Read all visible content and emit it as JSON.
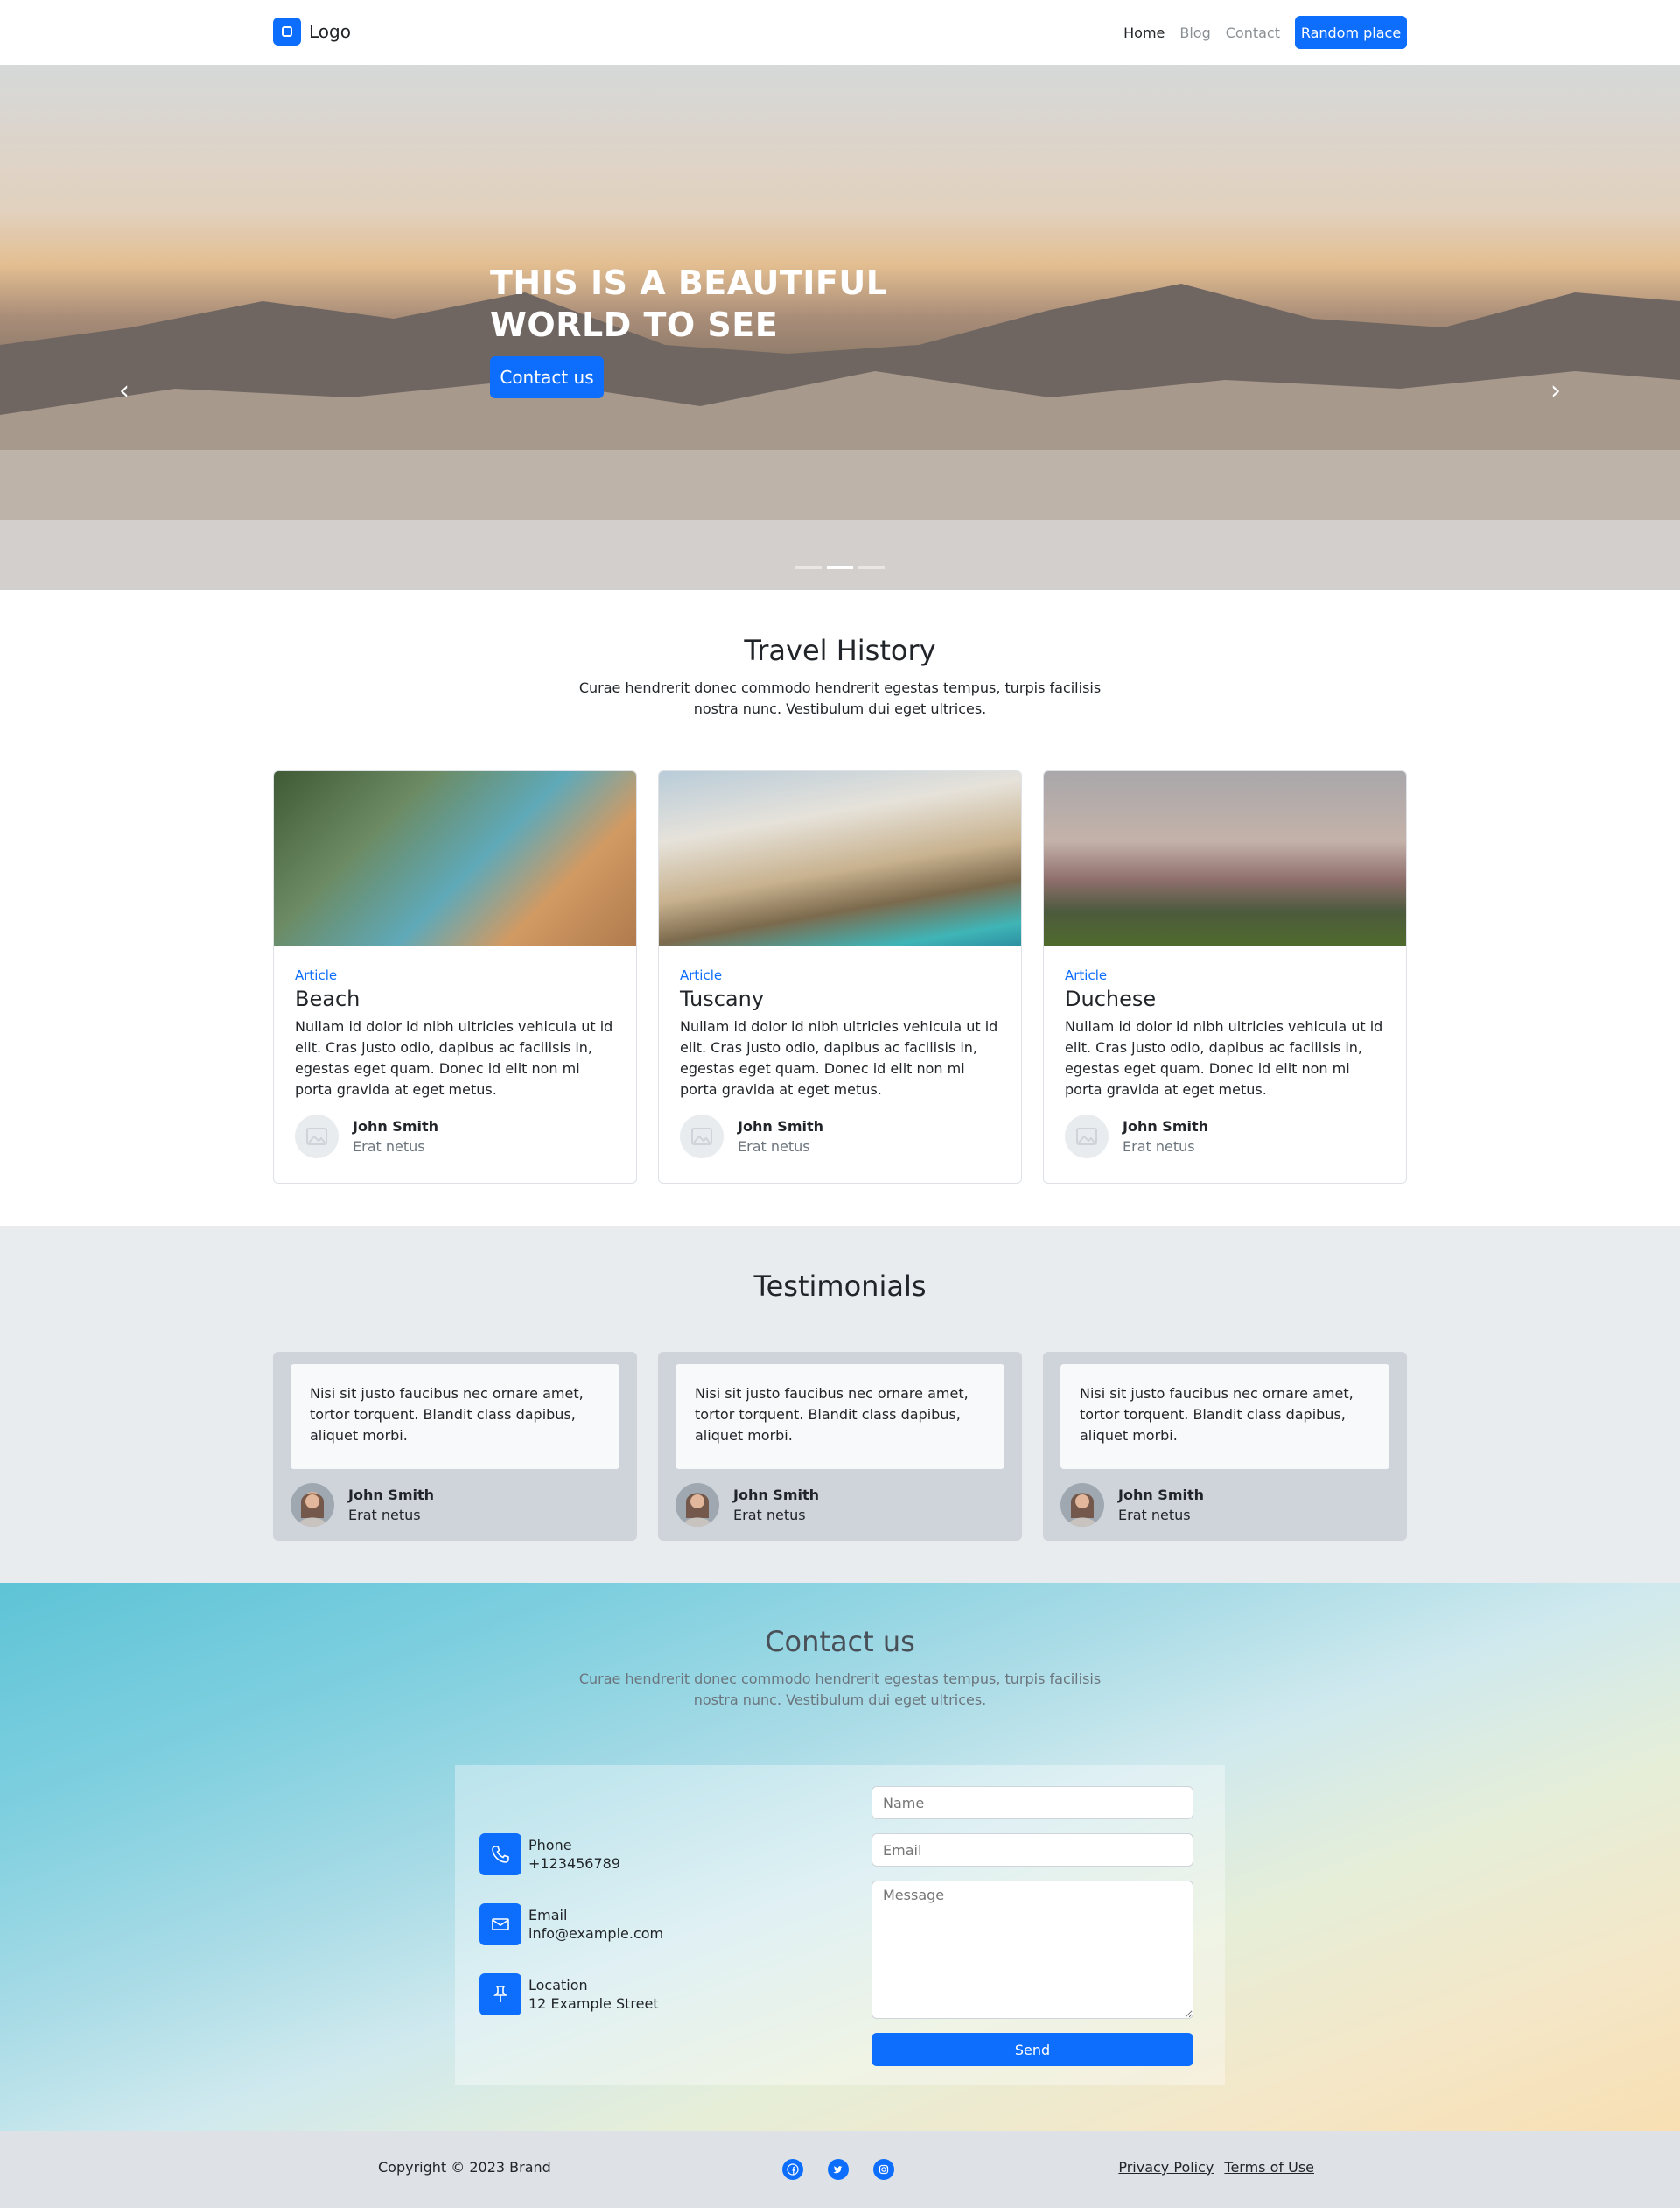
{
  "nav": {
    "brand": "Logo",
    "links": [
      "Home",
      "Blog",
      "Contact"
    ],
    "cta": "Random place"
  },
  "hero": {
    "title": "THIS IS A BEAUTIFUL WORLD TO SEE",
    "button": "Contact us"
  },
  "travel": {
    "heading": "Travel History",
    "subtitle": "Curae hendrerit donec commodo hendrerit egestas tempus, turpis facilisis nostra nunc. Vestibulum dui eget ultrices.",
    "cards": [
      {
        "tag": "Article",
        "title": "Beach",
        "text": "Nullam id dolor id nibh ultricies vehicula ut id elit. Cras justo odio, dapibus ac facilisis in, egestas eget quam. Donec id elit non mi porta gravida at eget metus.",
        "author": "John Smith",
        "role": "Erat netus"
      },
      {
        "tag": "Article",
        "title": "Tuscany",
        "text": "Nullam id dolor id nibh ultricies vehicula ut id elit. Cras justo odio, dapibus ac facilisis in, egestas eget quam. Donec id elit non mi porta gravida at eget metus.",
        "author": "John Smith",
        "role": "Erat netus"
      },
      {
        "tag": "Article",
        "title": "Duchese",
        "text": "Nullam id dolor id nibh ultricies vehicula ut id elit. Cras justo odio, dapibus ac facilisis in, egestas eget quam. Donec id elit non mi porta gravida at eget metus.",
        "author": "John Smith",
        "role": "Erat netus"
      }
    ]
  },
  "testimonials": {
    "heading": "Testimonials",
    "items": [
      {
        "quote": "Nisi sit justo faucibus nec ornare amet, tortor torquent. Blandit class dapibus, aliquet morbi.",
        "author": "John Smith",
        "role": "Erat netus"
      },
      {
        "quote": "Nisi sit justo faucibus nec ornare amet, tortor torquent. Blandit class dapibus, aliquet morbi.",
        "author": "John Smith",
        "role": "Erat netus"
      },
      {
        "quote": "Nisi sit justo faucibus nec ornare amet, tortor torquent. Blandit class dapibus, aliquet morbi.",
        "author": "John Smith",
        "role": "Erat netus"
      }
    ]
  },
  "contact": {
    "heading": "Contact us",
    "subtitle": "Curae hendrerit donec commodo hendrerit egestas tempus, turpis facilisis nostra nunc. Vestibulum dui eget ultrices.",
    "phone_label": "Phone",
    "phone_value": "+123456789",
    "email_label": "Email",
    "email_value": "info@example.com",
    "location_label": "Location",
    "location_value": "12 Example Street",
    "name_placeholder": "Name",
    "email_placeholder": "Email",
    "message_placeholder": "Message",
    "send": "Send"
  },
  "footer": {
    "copyright": "Copyright © 2023 Brand",
    "privacy": "Privacy Policy",
    "terms": "Terms of Use"
  },
  "icons": [
    "phone-icon",
    "envelope-icon",
    "pin-icon",
    "facebook-icon",
    "twitter-icon",
    "instagram-icon"
  ],
  "colors": {
    "primary": "#0d6efd",
    "muted_bg": "#e9ecef",
    "card_bg": "#ced4da"
  }
}
